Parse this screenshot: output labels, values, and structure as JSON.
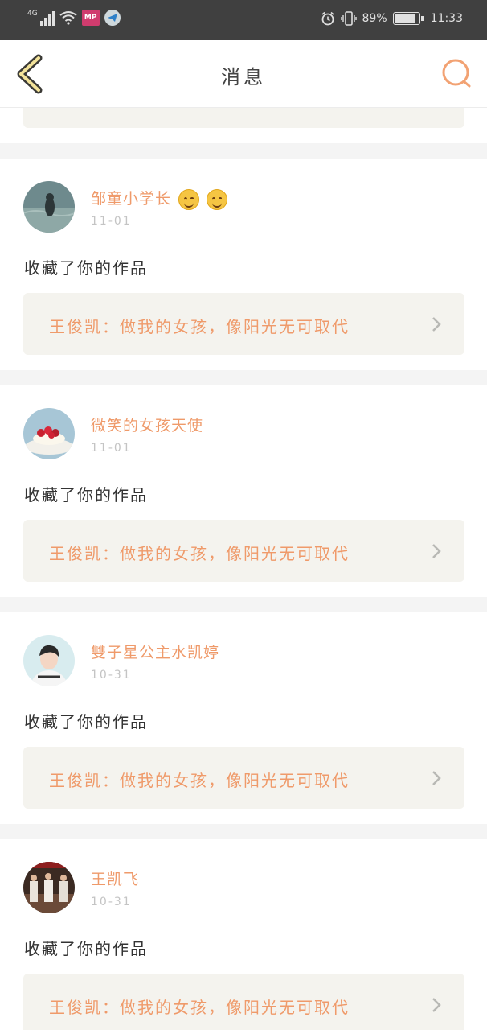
{
  "status_bar": {
    "network": "4G",
    "app_badge": "MP",
    "battery_percent": "89%",
    "battery_level": 0.89,
    "time": "11:33"
  },
  "nav": {
    "title": "消息",
    "back_icon": "chevron-left-icon",
    "search_icon": "search-icon"
  },
  "messages": [
    {
      "username": "邹童小学长",
      "emoji_count": 2,
      "date": "11-01",
      "action": "收藏了你的作品",
      "work_title": "王俊凯：做我的女孩，像阳光无可取代"
    },
    {
      "username": "微笑的女孩天使",
      "date": "11-01",
      "action": "收藏了你的作品",
      "work_title": "王俊凯：做我的女孩，像阳光无可取代"
    },
    {
      "username": "雙子星公主水凯婷",
      "date": "10-31",
      "action": "收藏了你的作品",
      "work_title": "王俊凯：做我的女孩，像阳光无可取代"
    },
    {
      "username": "王凯飞",
      "date": "10-31",
      "action": "收藏了你的作品",
      "work_title": "王俊凯：做我的女孩，像阳光无可取代"
    }
  ],
  "colors": {
    "accent": "#ef9a6a",
    "card_bg": "#f4f3ee",
    "status_bar": "#404040",
    "separator": "#f4f4f4"
  }
}
